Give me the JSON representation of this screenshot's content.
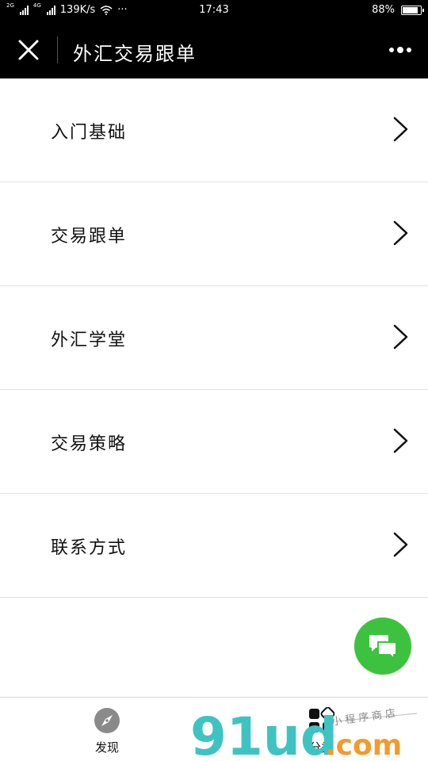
{
  "status_bar": {
    "network_1": "2G",
    "network_2": "4G",
    "speed": "139K/s",
    "more": "···",
    "time": "17:43",
    "battery_percent": "88%",
    "battery_level": 0.88
  },
  "title_bar": {
    "title": "外汇交易跟单",
    "close_icon": "close-icon",
    "more_icon": "more-icon"
  },
  "menu": {
    "items": [
      {
        "label": "入门基础",
        "icon": "chevron-right-icon"
      },
      {
        "label": "交易跟单",
        "icon": "chevron-right-icon"
      },
      {
        "label": "外汇学堂",
        "icon": "chevron-right-icon"
      },
      {
        "label": "交易策略",
        "icon": "chevron-right-icon"
      },
      {
        "label": "联系方式",
        "icon": "chevron-right-icon"
      }
    ]
  },
  "chat_button": {
    "icon": "chat-bubbles-icon",
    "color": "#3cc23f"
  },
  "tab_bar": {
    "tabs": [
      {
        "label": "发现",
        "icon": "compass-icon"
      },
      {
        "label": "分类",
        "icon": "category-icon"
      }
    ]
  },
  "watermark": {
    "brand": "91ud",
    "domain": ".com",
    "tagline": "小程序商店",
    "colors": {
      "teal": "#3fc3c2",
      "orange": "#f39a2b"
    }
  }
}
